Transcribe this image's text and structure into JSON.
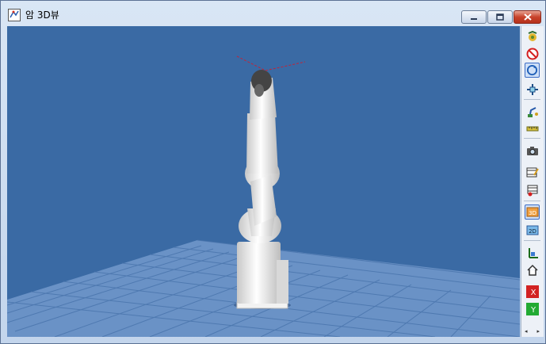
{
  "window": {
    "title": "암 3D뷰",
    "controls": [
      "minimize",
      "maximize",
      "close"
    ]
  },
  "viewport": {
    "background": "#3a6aa4",
    "floor_colors": [
      "#5680b8",
      "#7aa0cf"
    ],
    "robot_color": "#f2f2f2"
  },
  "toolbar": {
    "items": [
      {
        "id": "robot-settings",
        "icon": "robot-gear-icon"
      },
      {
        "id": "no-collision",
        "icon": "no-symbol-icon"
      },
      {
        "id": "rotate",
        "icon": "rotate-icon",
        "active": true
      },
      {
        "id": "move",
        "icon": "move-cross-icon"
      },
      {
        "id": "teach",
        "icon": "teach-arm-icon"
      },
      {
        "id": "measure",
        "icon": "ruler-icon"
      },
      {
        "id": "capture",
        "icon": "camera-icon"
      },
      {
        "id": "record-edit",
        "icon": "film-edit-icon"
      },
      {
        "id": "record",
        "icon": "film-record-icon"
      },
      {
        "id": "view-3d",
        "icon": "cube-3d-icon",
        "label": "3D",
        "active": true
      },
      {
        "id": "view-2d",
        "icon": "plane-2d-icon",
        "label": "2D"
      },
      {
        "id": "axes",
        "icon": "axes-icon"
      },
      {
        "id": "home",
        "icon": "home-icon"
      },
      {
        "id": "x-minus",
        "icon": "x-axis-icon",
        "label": "X"
      },
      {
        "id": "y-plus",
        "icon": "y-axis-icon",
        "label": "Y"
      }
    ]
  }
}
